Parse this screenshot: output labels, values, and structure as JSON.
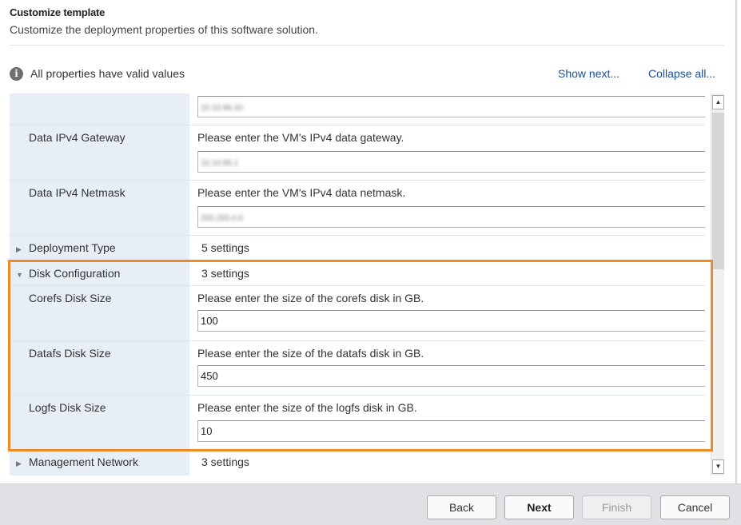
{
  "header": {
    "title": "Customize template",
    "subtitle": "Customize the deployment properties of this software solution."
  },
  "status": {
    "icon": "info-icon",
    "text": "All properties have valid values",
    "show_next": "Show next...",
    "collapse_all": "Collapse all..."
  },
  "rows": {
    "top_partial": {
      "value": "10.10.96.20"
    },
    "gateway": {
      "label": "Data IPv4 Gateway",
      "description": "Please enter the VM's IPv4 data gateway.",
      "value": "10.10.96.1"
    },
    "netmask": {
      "label": "Data IPv4 Netmask",
      "description": "Please enter the VM's IPv4 data netmask.",
      "value": "255.255.0.0"
    },
    "deployment_type": {
      "label": "Deployment Type",
      "count": "5 settings"
    },
    "disk_configuration": {
      "label": "Disk Configuration",
      "count": "3 settings"
    },
    "corefs": {
      "label": "Corefs Disk Size",
      "description": "Please enter the size of the corefs disk in GB.",
      "value": "100"
    },
    "datafs": {
      "label": "Datafs Disk Size",
      "description": "Please enter the size of the datafs disk in GB.",
      "value": "450"
    },
    "logfs": {
      "label": "Logfs Disk Size",
      "description": "Please enter the size of the logfs disk in GB.",
      "value": "10"
    },
    "management_network": {
      "label": "Management Network",
      "count": "3 settings"
    }
  },
  "footer": {
    "back": "Back",
    "next": "Next",
    "finish": "Finish",
    "cancel": "Cancel"
  },
  "colors": {
    "highlight": "#f08a24",
    "label_column": "#e7eef6",
    "link": "#1a4d99"
  }
}
